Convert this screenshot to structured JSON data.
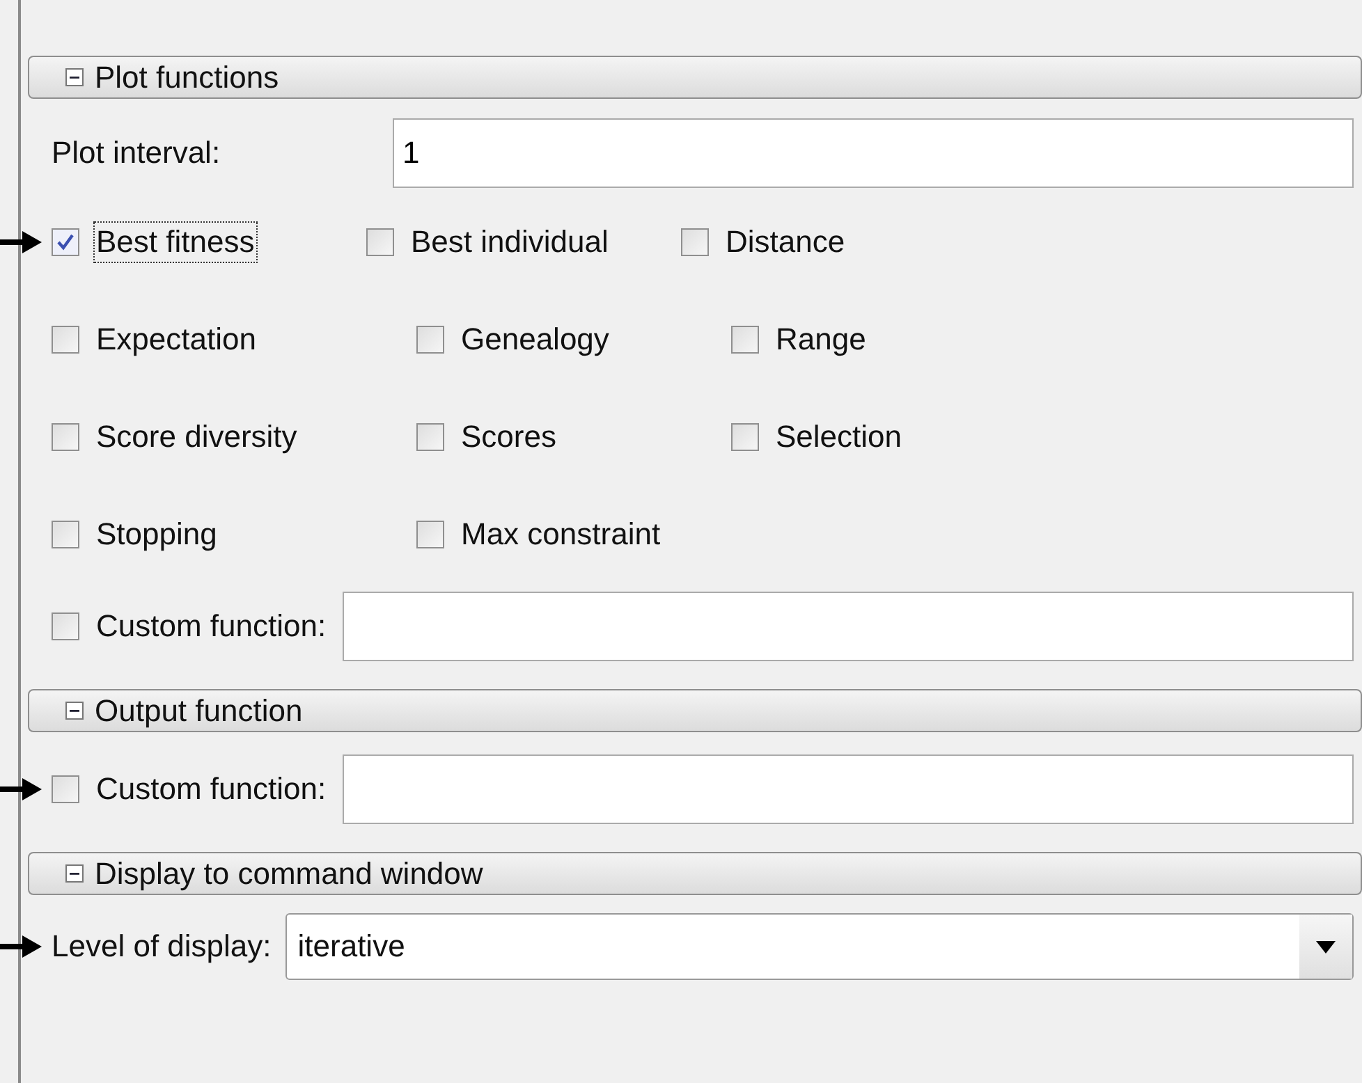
{
  "sections": [
    {
      "title": "Plot functions",
      "expanded": true,
      "rows": [
        {
          "kind": "field",
          "label": "Plot interval:",
          "value": "1",
          "pointer": false
        },
        {
          "kind": "checkboxes",
          "pointer": true,
          "items": [
            {
              "label": "Best fitness",
              "checked": true,
              "focused": true
            },
            {
              "label": "Best individual",
              "checked": false,
              "focused": false
            },
            {
              "label": "Distance",
              "checked": false,
              "focused": false
            }
          ]
        },
        {
          "kind": "checkboxes",
          "pointer": false,
          "items": [
            {
              "label": "Expectation",
              "checked": false,
              "focused": false
            },
            {
              "label": "Genealogy",
              "checked": false,
              "focused": false
            },
            {
              "label": "Range",
              "checked": false,
              "focused": false
            }
          ]
        },
        {
          "kind": "checkboxes",
          "pointer": false,
          "items": [
            {
              "label": "Score diversity",
              "checked": false,
              "focused": false
            },
            {
              "label": "Scores",
              "checked": false,
              "focused": false
            },
            {
              "label": "Selection",
              "checked": false,
              "focused": false
            }
          ]
        },
        {
          "kind": "checkboxes",
          "pointer": false,
          "items": [
            {
              "label": "Stopping",
              "checked": false,
              "focused": false
            },
            {
              "label": "Max constraint",
              "checked": false,
              "focused": false
            }
          ]
        },
        {
          "kind": "checkbox_field",
          "label": "Custom function:",
          "checked": false,
          "pointer": false
        }
      ]
    },
    {
      "title": "Output function",
      "expanded": true,
      "rows": [
        {
          "kind": "checkbox_field",
          "label": "Custom function:",
          "checked": false,
          "pointer": true
        }
      ]
    },
    {
      "title": "Display to command window",
      "expanded": true,
      "rows": [
        {
          "kind": "dropdown",
          "label": "Level of display:",
          "value": "iterative",
          "pointer": true
        }
      ]
    }
  ]
}
